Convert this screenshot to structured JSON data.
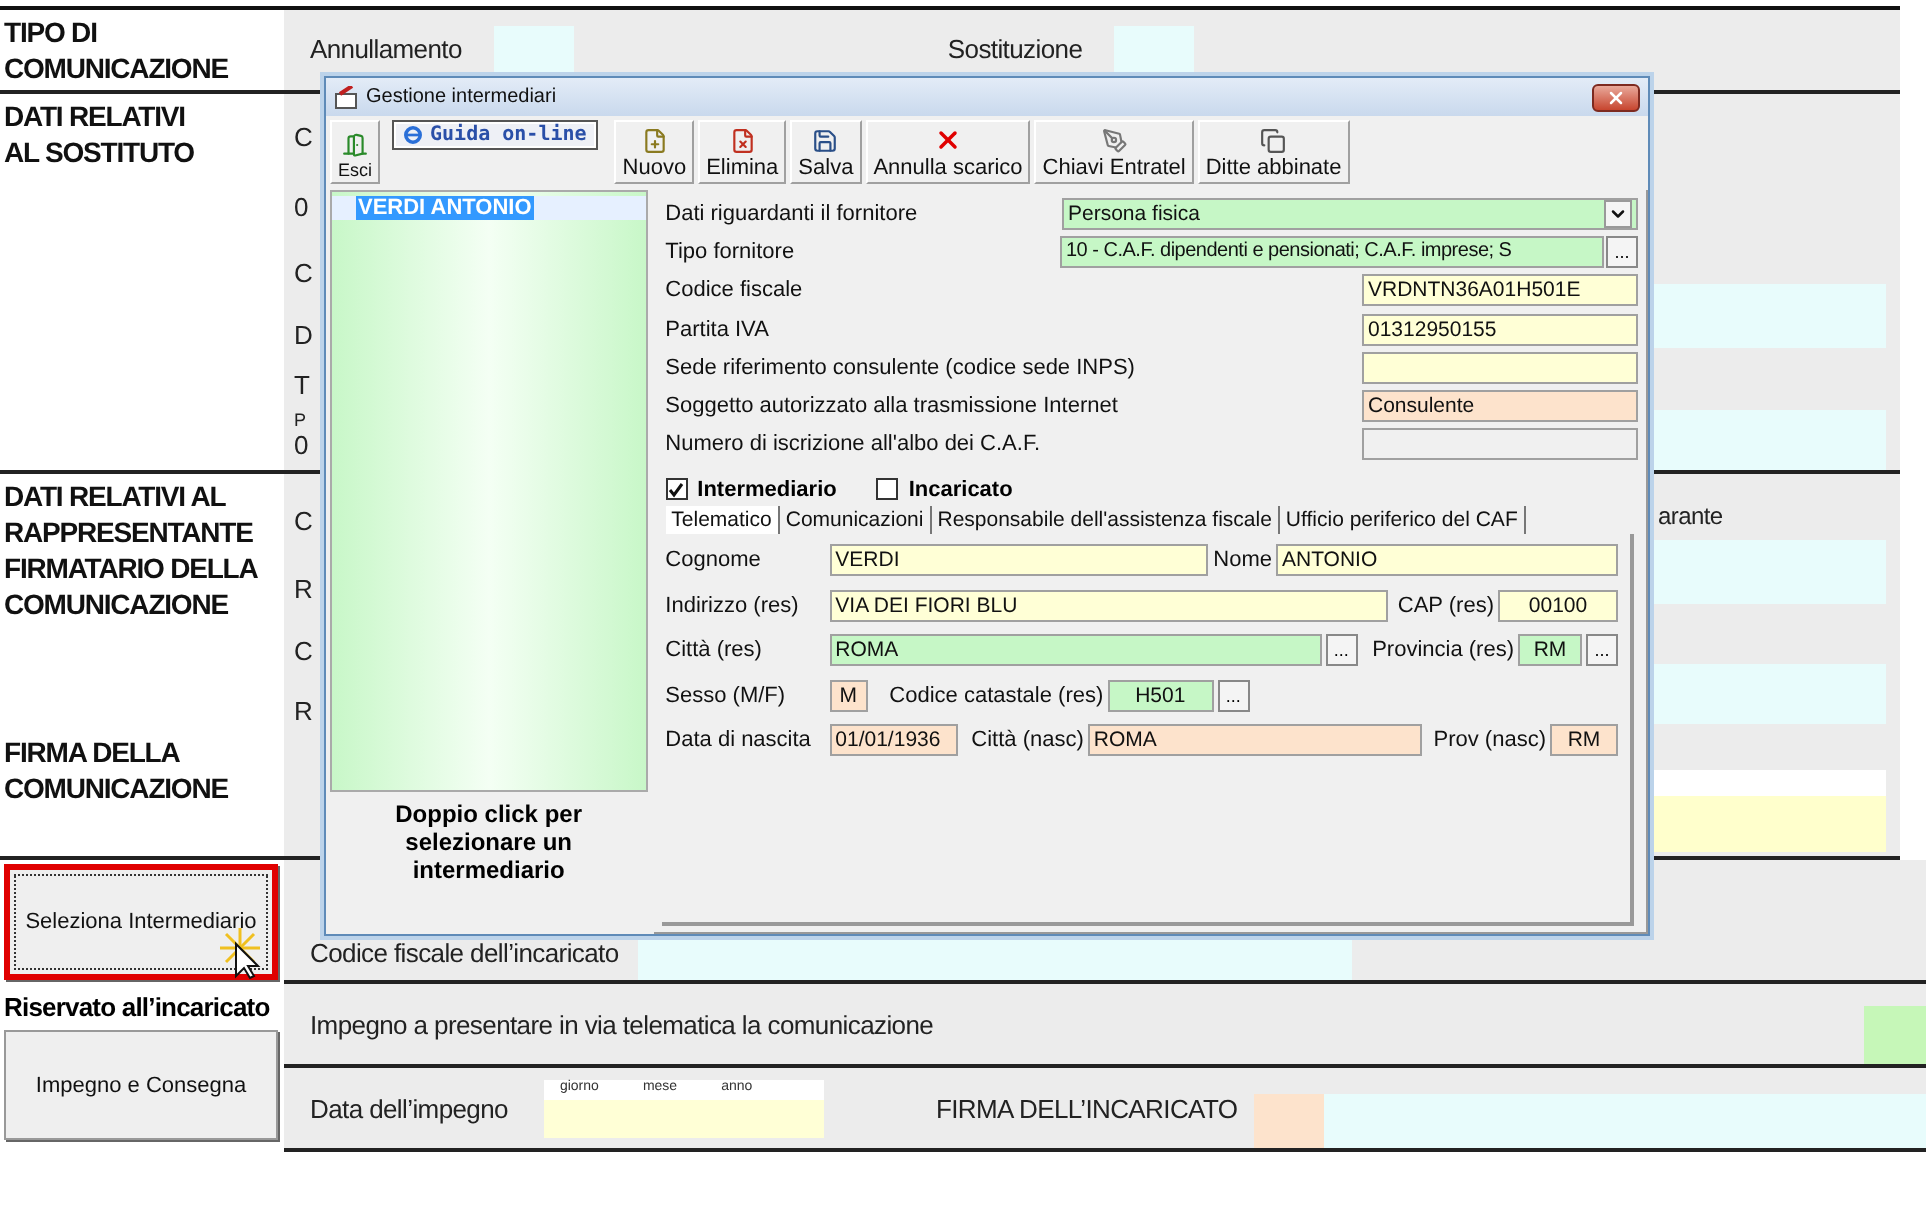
{
  "form": {
    "sections": [
      {
        "kind": "type",
        "title": "TIPO DI\nCOMUNICAZIONE",
        "options": [
          "Annullamento",
          "Sostituzione"
        ]
      },
      {
        "kind": "substitute",
        "title": "DATI RELATIVI\nAL SOSTITUTO",
        "fragments": [
          "C",
          "0",
          "C",
          "D",
          "T",
          "P",
          "0"
        ]
      },
      {
        "kind": "representative",
        "title": "DATI RELATIVI AL\nRAPPRESENTANTE\nFIRMATARIO DELLA\nCOMUNICAZIONE",
        "fragments": [
          "C",
          "R",
          "C",
          "R"
        ],
        "side_text": "arante"
      },
      {
        "kind": "signature",
        "title": "FIRMA DELLA\nCOMUNICAZIONE"
      }
    ],
    "select_button": "Seleziona Intermediario",
    "tax_code_label": "Codice fiscale dell’incaricato",
    "reserved_title": "Riservato all’incaricato",
    "commit_button": "Impegno e Consegna",
    "commit_label": "Impegno a presentare in via telematica la comunicazione",
    "date_label": "Data dell’impegno",
    "date_parts": [
      "giorno",
      "mese",
      "anno"
    ],
    "signature_label": "FIRMA DELL’INCARICATO"
  },
  "dialog": {
    "title": "Gestione intermediari",
    "toolbar": [
      {
        "kind": "exit",
        "label": "Esci"
      },
      {
        "kind": "help",
        "label": "Guida on-line"
      },
      {
        "kind": "new",
        "label": "Nuovo"
      },
      {
        "kind": "delete",
        "label": "Elimina"
      },
      {
        "kind": "save",
        "label": "Salva"
      },
      {
        "kind": "cancel",
        "label": "Annulla scarico"
      },
      {
        "kind": "keys",
        "label": "Chiavi Entratel"
      },
      {
        "kind": "linked",
        "label": "Ditte abbinate"
      }
    ],
    "list": {
      "items": [
        {
          "label": "VERDI ANTONIO",
          "selected": true
        }
      ],
      "hint": "Doppio click per selezionare un intermediario"
    },
    "fields": [
      {
        "kind": "select",
        "label": "Dati riguardanti il fornitore",
        "value": "Persona fisica",
        "color": "#c6f7c6"
      },
      {
        "kind": "picker",
        "label": "Tipo fornitore",
        "value": "10 - C.A.F. dipendenti e pensionati; C.A.F. imprese; S",
        "button": "...",
        "color": "#c6f7c6"
      },
      {
        "kind": "text",
        "label": "Codice fiscale",
        "value": "VRDNTN36A01H501E",
        "color": "#ffffd6"
      },
      {
        "kind": "text",
        "label": "Partita IVA",
        "value": "01312950155",
        "color": "#ffffd6"
      },
      {
        "kind": "text",
        "label": "Sede riferimento consulente (codice sede INPS)",
        "color": "#ffffd6"
      },
      {
        "kind": "text",
        "label": "Soggetto autorizzato alla trasmissione Internet",
        "value": "Consulente",
        "color": "#fde3cc"
      },
      {
        "kind": "text",
        "label": "Numero di iscrizione all'albo dei C.A.F.",
        "color": "#f0f0f0"
      }
    ],
    "checkboxes": [
      {
        "label": "Intermediario",
        "checked": true
      },
      {
        "label": "Incaricato",
        "checked": false
      }
    ],
    "tabs": [
      {
        "label": "Telematico",
        "selected": true
      },
      {
        "label": "Comunicazioni",
        "selected": false
      },
      {
        "label": "Responsabile dell'assistenza fiscale",
        "selected": false
      },
      {
        "label": "Ufficio periferico del CAF",
        "selected": false
      }
    ],
    "panel_rows": [
      [
        {
          "label": "Cognome",
          "value": "VERDI",
          "color": "#ffffd6"
        },
        {
          "label": "Nome",
          "value": "ANTONIO",
          "color": "#ffffd6"
        }
      ],
      [
        {
          "label": "Indirizzo (res)",
          "value": "VIA DEI FIORI BLU",
          "color": "#ffffd6"
        },
        {
          "label": "CAP (res)",
          "value": "00100",
          "color": "#ffffd6"
        }
      ],
      [
        {
          "label": "Città (res)",
          "value": "ROMA",
          "color": "#c6f7c6",
          "button": "..."
        },
        {
          "label": "Provincia (res)",
          "value": "RM",
          "color": "#c6f7c6",
          "button": "..."
        }
      ],
      [
        {
          "label": "Sesso (M/F)",
          "value": "M",
          "color": "#fde3cc"
        },
        {
          "label": "Codice catastale (res)",
          "value": "H501",
          "color": "#c6f7c6",
          "button": "..."
        }
      ],
      [
        {
          "label": "Data di nascita",
          "value": "01/01/1936",
          "color": "#fde3cc"
        },
        {
          "label": "Città (nasc)",
          "value": "ROMA",
          "color": "#fde3cc"
        },
        {
          "label": "Prov (nasc)",
          "value": "RM",
          "color": "#fde3cc"
        }
      ]
    ]
  }
}
